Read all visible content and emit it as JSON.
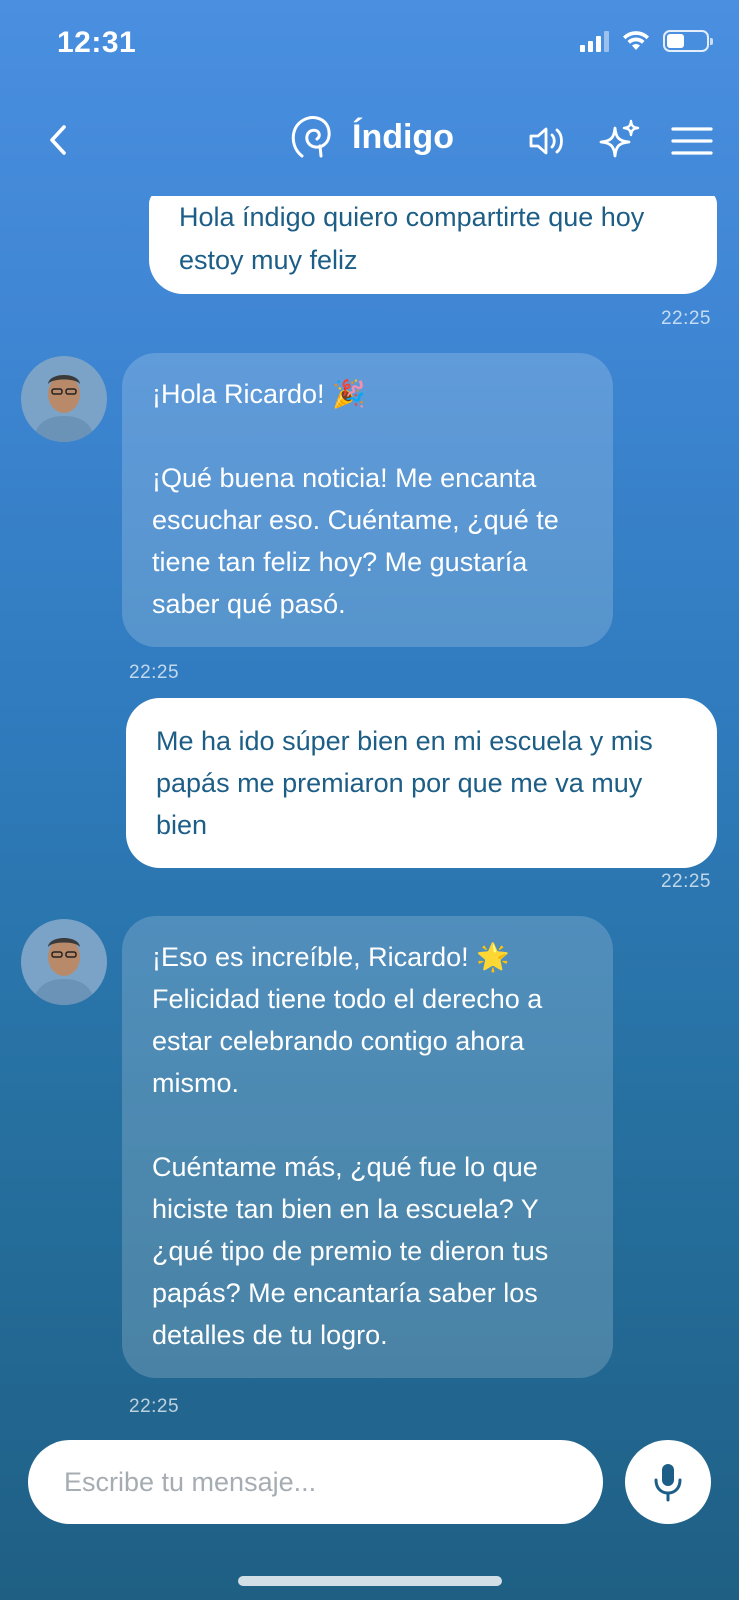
{
  "status_bar": {
    "time": "12:31",
    "battery_level": 0.45,
    "signal_bars": 4,
    "signal_active": 3
  },
  "header": {
    "back_icon": "chevron-left-icon",
    "logo_icon": "spiral-brain-icon",
    "title": "Índigo",
    "sound_icon": "speaker-icon",
    "sparkles_icon": "sparkles-icon",
    "menu_icon": "hamburger-menu-icon"
  },
  "messages": [
    {
      "from": "user",
      "text": "Hola índigo quiero compartirte que hoy estoy muy feliz",
      "time": "22:25"
    },
    {
      "from": "assistant",
      "paragraphs": [
        "¡Hola Ricardo! 🎉",
        "¡Qué buena noticia! Me encanta escuchar eso. Cuéntame, ¿qué te tiene tan feliz hoy? Me gustaría saber qué pasó."
      ],
      "time": "22:25"
    },
    {
      "from": "user",
      "text": "Me ha ido súper bien en mi escuela y mis papás me premiaron por que me va muy bien",
      "time": "22:25"
    },
    {
      "from": "assistant",
      "paragraphs": [
        "¡Eso es increíble, Ricardo! 🌟 Felicidad tiene todo el derecho a estar celebrando contigo ahora mismo.",
        "Cuéntame más, ¿qué fue lo que hiciste tan bien en la escuela? Y ¿qué tipo de premio te dieron tus papás? Me encantaría saber los detalles de tu logro."
      ],
      "time": "22:25"
    }
  ],
  "composer": {
    "placeholder": "Escribe tu mensaje...",
    "value": "",
    "mic_icon": "microphone-icon"
  },
  "colors": {
    "accent": "#3f86d4",
    "user_text": "#1d5e86",
    "bubble_out": "#ffffff"
  }
}
